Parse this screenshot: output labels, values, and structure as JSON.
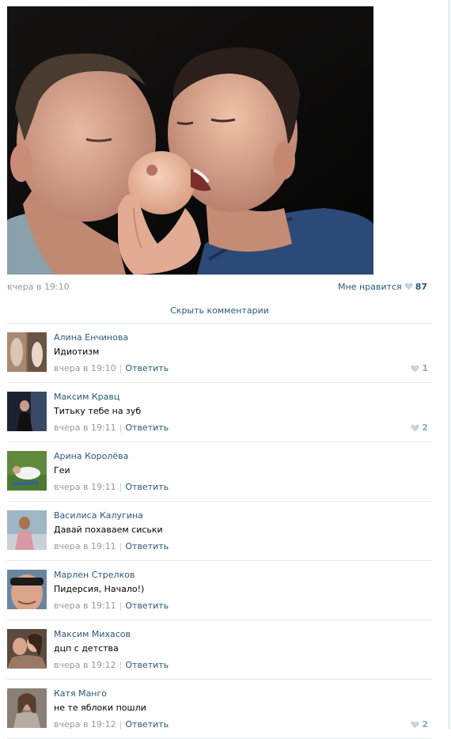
{
  "post": {
    "time": "вчера в 19:10",
    "like_label": "Мне нравится",
    "like_count": "87"
  },
  "hide_comments_label": "Скрыть комментарии",
  "comments": [
    {
      "author": "Алина Енчинова",
      "text": "Идиотизм",
      "time": "вчера в 19:10",
      "sep": "|",
      "reply": "Ответить",
      "likes": "1"
    },
    {
      "author": "Максим Кравц",
      "text": "Титьку тебе на зуб",
      "time": "вчера в 19:11",
      "sep": "|",
      "reply": "Ответить",
      "likes": "2"
    },
    {
      "author": "Арина Королёва",
      "text": "Геи",
      "time": "вчера в 19:11",
      "sep": "|",
      "reply": "Ответить",
      "likes": ""
    },
    {
      "author": "Василиса Калугина",
      "text": "Давай похаваем сиськи",
      "time": "вчера в 19:11",
      "sep": "|",
      "reply": "Ответить",
      "likes": ""
    },
    {
      "author": "Марлен Стрелков",
      "text": "Пидерсия, Начало!)",
      "time": "вчера в 19:11",
      "sep": "|",
      "reply": "Ответить",
      "likes": ""
    },
    {
      "author": "Максим Михасов",
      "text": "дцп с детства",
      "time": "вчера в 19:12",
      "sep": "|",
      "reply": "Ответить",
      "likes": ""
    },
    {
      "author": "Катя Манго",
      "text": "не те яблоки пошли",
      "time": "вчера в 19:12",
      "sep": "|",
      "reply": "Ответить",
      "likes": "2"
    }
  ],
  "colors": {
    "link": "#2b587a",
    "meta_gray": "#999999",
    "divider": "#e4e8ed",
    "heart": "#c8d3df"
  }
}
